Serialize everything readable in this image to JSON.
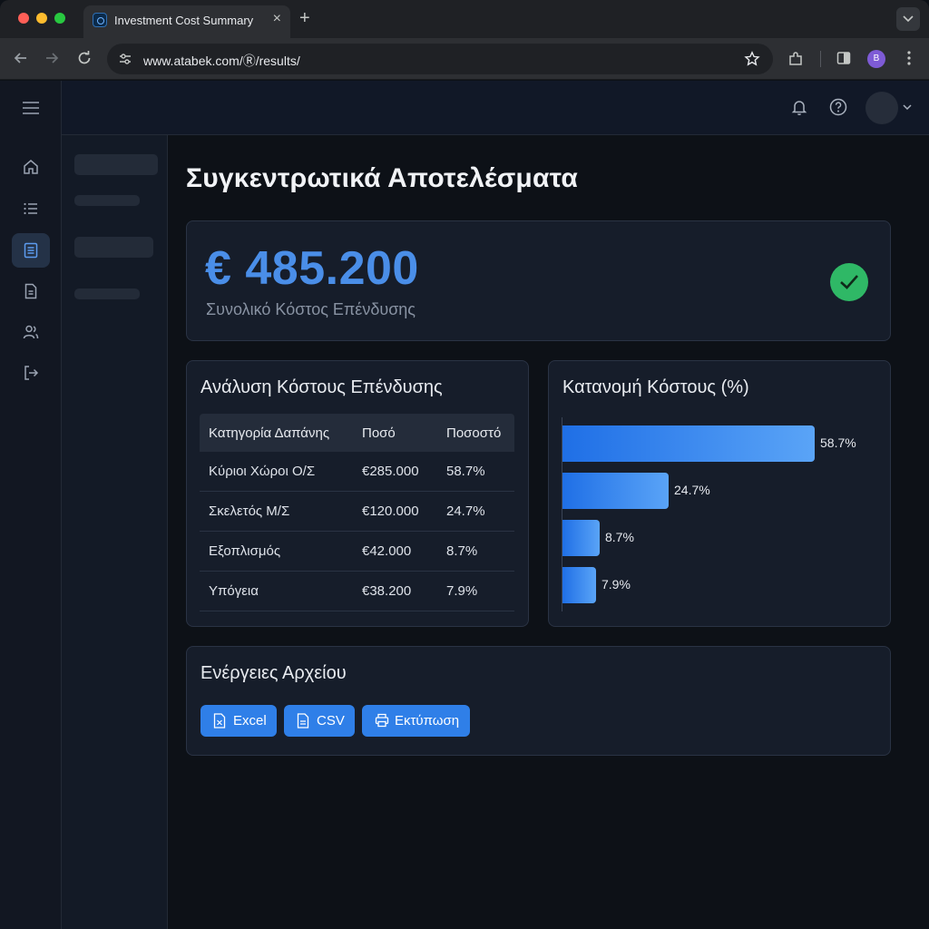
{
  "browser": {
    "tab_title": "Investment Cost Summary",
    "url": "www.atabek.com/Ⓡ/results/",
    "profile_initial": "B"
  },
  "page": {
    "title": "Συγκεντρωτικά Αποτελέσματα"
  },
  "summary": {
    "total_value": "€ 485.200",
    "total_label": "Συνολικό Κόστος Επένδυσης",
    "status_color": "#2fb866"
  },
  "breakdown": {
    "title": "Ανάλυση Κόστους Επένδυσης",
    "headers": [
      "Κατηγορία Δαπάνης",
      "Ποσό",
      "Ποσοστό"
    ],
    "rows": [
      {
        "category": "Κύριοι Χώροι Ο/Σ",
        "amount": "€285.000",
        "percent": "58.7%"
      },
      {
        "category": "Σκελετός Μ/Σ",
        "amount": "€120.000",
        "percent": "24.7%"
      },
      {
        "category": "Εξοπλισμός",
        "amount": "€42.000",
        "percent": "8.7%"
      },
      {
        "category": "Υπόγεια",
        "amount": "€38.200",
        "percent": "7.9%"
      }
    ]
  },
  "allocation": {
    "title": "Κατανομή Κόστους (%)"
  },
  "chart_data": {
    "type": "bar",
    "orientation": "horizontal",
    "categories": [
      "Κύριοι Χώροι Ο/Σ",
      "Σκελετός Μ/Σ",
      "Εξοπλισμός",
      "Υπόγεια"
    ],
    "values": [
      58.7,
      24.7,
      8.7,
      7.9
    ],
    "value_labels": [
      "58.7%",
      "24.7%",
      "8.7%",
      "7.9%"
    ],
    "title": "Κατανομή Κόστους (%)",
    "xlim": [
      0,
      60
    ],
    "grid": false,
    "bar_color": "#2f7fe8"
  },
  "file_actions": {
    "title": "Ενέργειες Αρχείου",
    "buttons": [
      {
        "label": "Excel",
        "icon": "excel-file-icon"
      },
      {
        "label": "CSV",
        "icon": "csv-file-icon"
      },
      {
        "label": "Εκτύπωση",
        "icon": "printer-icon"
      }
    ]
  },
  "colors": {
    "accent": "#2f7fe8",
    "background": "#0d1117",
    "card": "#161d2a"
  }
}
